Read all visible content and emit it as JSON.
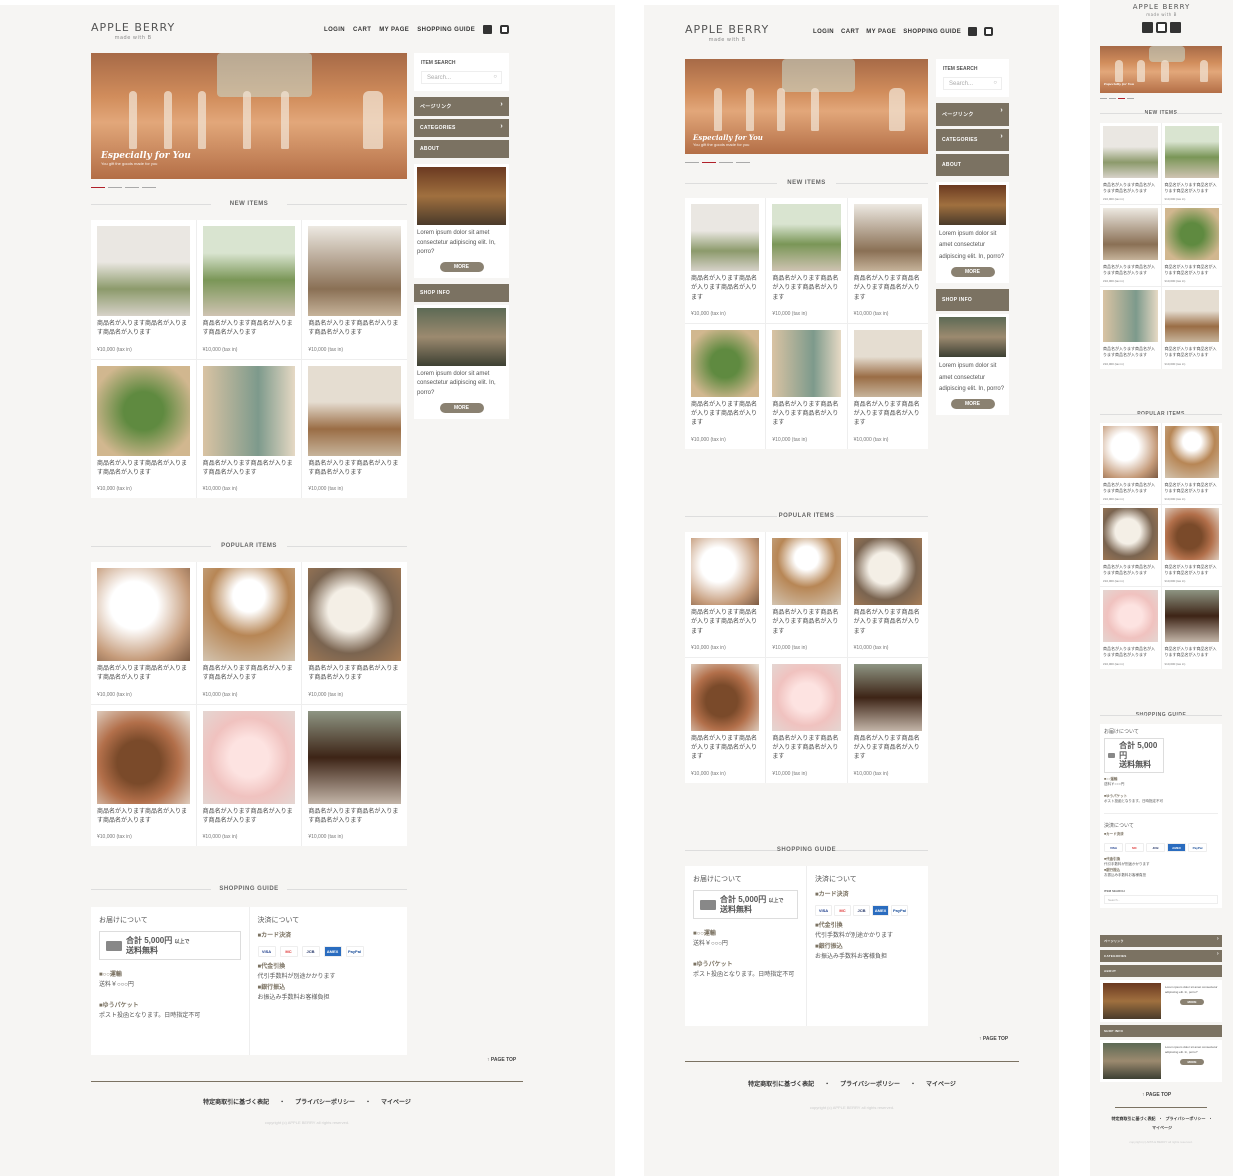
{
  "site": {
    "logo": "APPLE BERRY",
    "tagline": "made with B"
  },
  "nav": [
    "LOGIN",
    "CART",
    "MY PAGE",
    "SHOPPING GUIDE"
  ],
  "hero": {
    "title": "Especially for You",
    "subtitle": "You gift the goods made for you"
  },
  "sections": {
    "new_items": "NEW ITEMS",
    "popular_items": "POPULAR ITEMS",
    "shopping_guide": "SHOPPING GUIDE"
  },
  "product": {
    "name_desktop": "商品名が入ります商品名が入ります商品名が入ります",
    "name_tablet": "商品名が入ります商品名が入ります商品名が入ります",
    "price": "¥10,000 (tax in)"
  },
  "sidebar": {
    "search_label": "ITEM SEARCH",
    "search_placeholder": "Search...",
    "links": [
      "ページリンク",
      "CATEGORIES",
      "ABOUT"
    ],
    "shop_info": "SHOP INFO",
    "blurb": "Lorem ipsum dolor sit amet consectetur adipiscing elit. In, porro?",
    "more": "MORE"
  },
  "guide": {
    "delivery_title": "お届けについて",
    "payment_title": "決済について",
    "free_shipping_main": "合計 5,000円",
    "free_shipping_note": "以上で",
    "free_shipping": "送料無料",
    "shipping_head": "■○○運輸",
    "shipping_fee": "送料￥○○○円",
    "yupacket_head": "■ゆうパケット",
    "yupacket_text": "ポスト投函となります。日時指定不可",
    "card_head": "■カード決済",
    "cards": [
      "VISA",
      "MC",
      "JCB",
      "AMEX",
      "PayPal"
    ],
    "cod_head": "■代金引換",
    "cod_text": "代引手数料が別途かかります",
    "bank_head": "■銀行振込",
    "bank_text": "お振込み手数料お客様負担"
  },
  "page_top": "PAGE TOP",
  "footer": {
    "links": [
      "特定商取引に基づく表記",
      "・",
      "プライバシーポリシー",
      "・",
      "マイページ"
    ],
    "copyright": "copyright (c) APPLE BERRY all rights reserved."
  }
}
